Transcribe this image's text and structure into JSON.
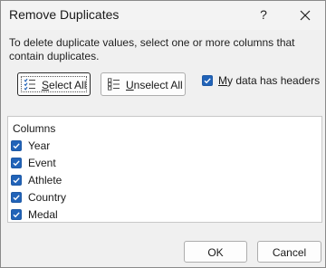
{
  "window": {
    "title": "Remove Duplicates",
    "help_glyph": "?",
    "close_icon": "close-icon"
  },
  "instructions": "To delete duplicate values, select one or more columns that contain duplicates.",
  "buttons": {
    "select_all": {
      "label_pre": "",
      "label_key": "S",
      "label_post": "elect All"
    },
    "unselect_all": {
      "label_pre": "",
      "label_key": "U",
      "label_post": "nselect All"
    },
    "ok": "OK",
    "cancel": "Cancel"
  },
  "my_data_has_headers": {
    "checked": true,
    "label_key": "M",
    "label_post": "y data has headers"
  },
  "columns": {
    "header": "Columns",
    "items": [
      {
        "label": "Year",
        "checked": true
      },
      {
        "label": "Event",
        "checked": true
      },
      {
        "label": "Athlete",
        "checked": true
      },
      {
        "label": "Country",
        "checked": true
      },
      {
        "label": "Medal",
        "checked": true
      }
    ]
  },
  "colors": {
    "checkbox_fill": "#2163b8",
    "dialog_bg": "#f0f0f0"
  }
}
